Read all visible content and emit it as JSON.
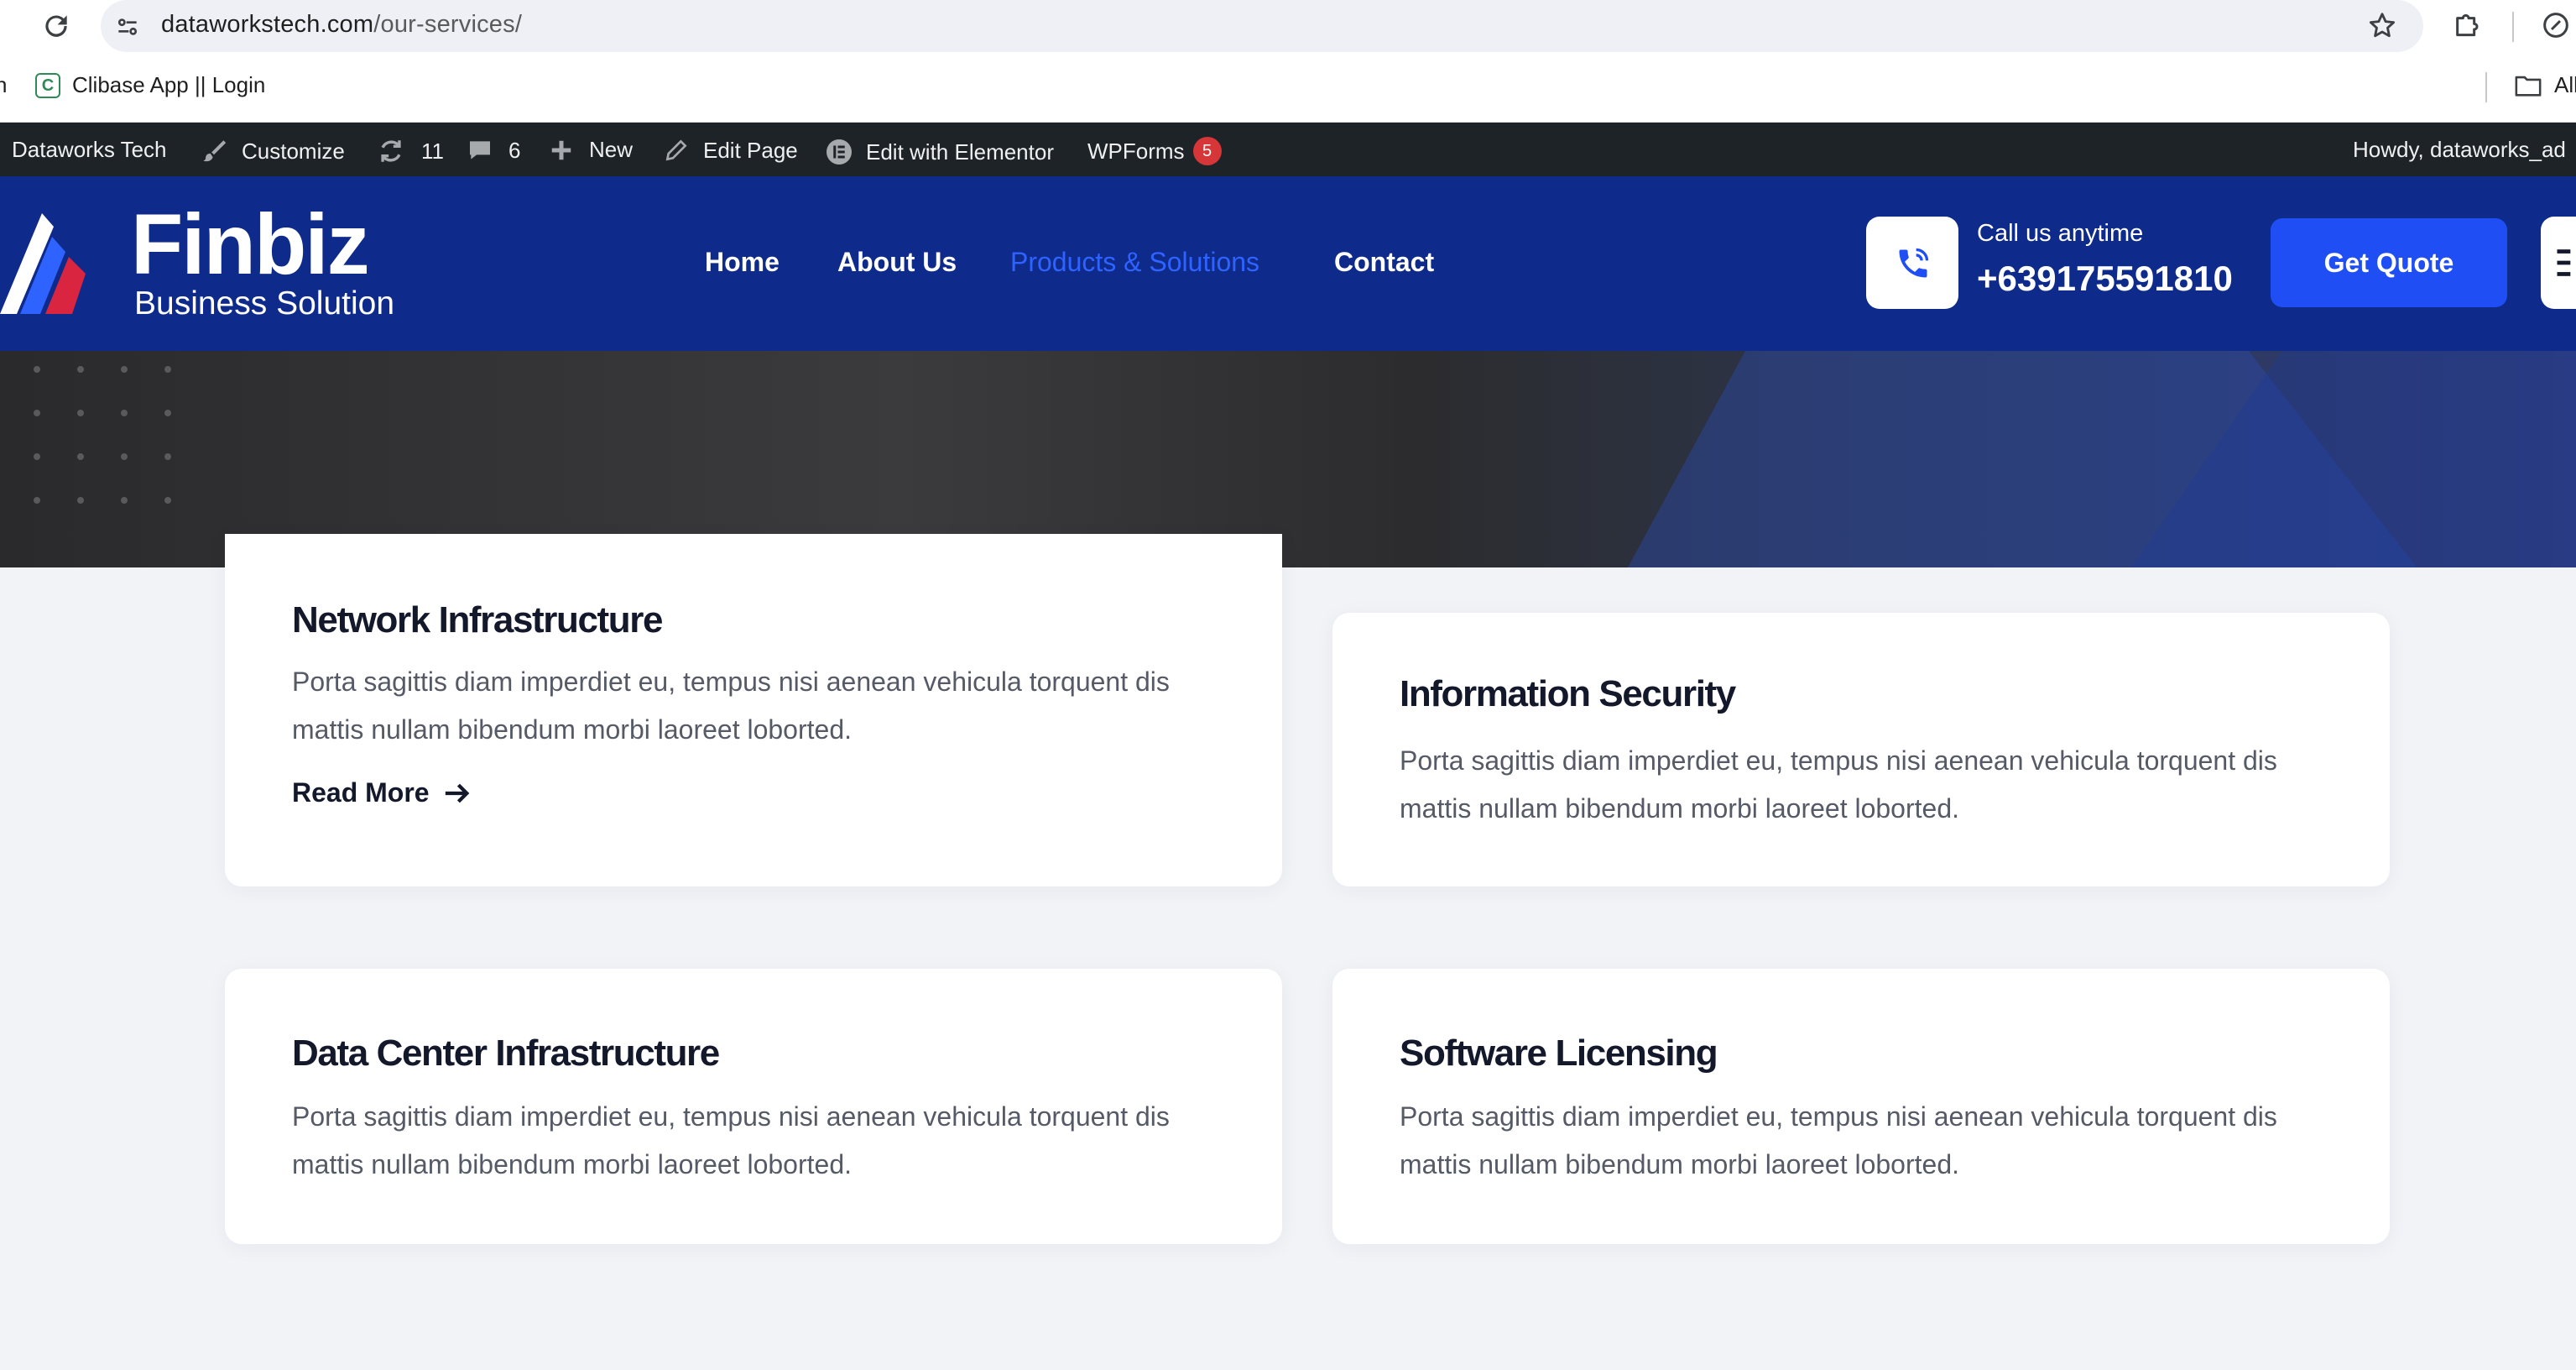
{
  "browser": {
    "url_domain": "dataworkstech.com",
    "url_path": "/our-services/",
    "bookmark_label": "Clibase App || Login",
    "bookmarks_overflow_label": "All"
  },
  "admin_bar": {
    "site_name": "Dataworks Tech",
    "customize": "Customize",
    "updates_count": "11",
    "comments_count": "6",
    "new_label": "New",
    "edit_page": "Edit Page",
    "edit_elementor": "Edit with Elementor",
    "wpforms": "WPForms",
    "wpforms_badge": "5",
    "howdy": "Howdy, dataworks_ad"
  },
  "header": {
    "logo_title": "Finbiz",
    "logo_subtitle": "Business Solution",
    "nav": [
      "Home",
      "About Us",
      "Products & Solutions",
      "Contact"
    ],
    "active_nav": "Products & Solutions",
    "call_label": "Call us anytime",
    "phone": "+639175591810",
    "cta": "Get Quote"
  },
  "services": [
    {
      "title": "Network Infrastructure",
      "text": "Porta sagittis diam imperdiet eu, tempus nisi aenean vehicula torquent dis mattis nullam bibendum morbi laoreet loborted.",
      "link": "Read More"
    },
    {
      "title": "Information Security",
      "text": "Porta sagittis diam imperdiet eu, tempus nisi aenean vehicula torquent dis mattis nullam bibendum morbi laoreet loborted."
    },
    {
      "title": "Data Center Infrastructure",
      "text": "Porta sagittis diam imperdiet eu, tempus nisi aenean vehicula torquent dis mattis nullam bibendum morbi laoreet loborted."
    },
    {
      "title": "Software Licensing",
      "text": "Porta sagittis diam imperdiet eu, tempus nisi aenean vehicula torquent dis mattis nullam bibendum morbi laoreet loborted."
    }
  ],
  "colors": {
    "header_bg": "#0e2a8b",
    "accent": "#1f4ef5",
    "active_nav": "#2f63ff",
    "admin_bar_bg": "#1d2327"
  }
}
